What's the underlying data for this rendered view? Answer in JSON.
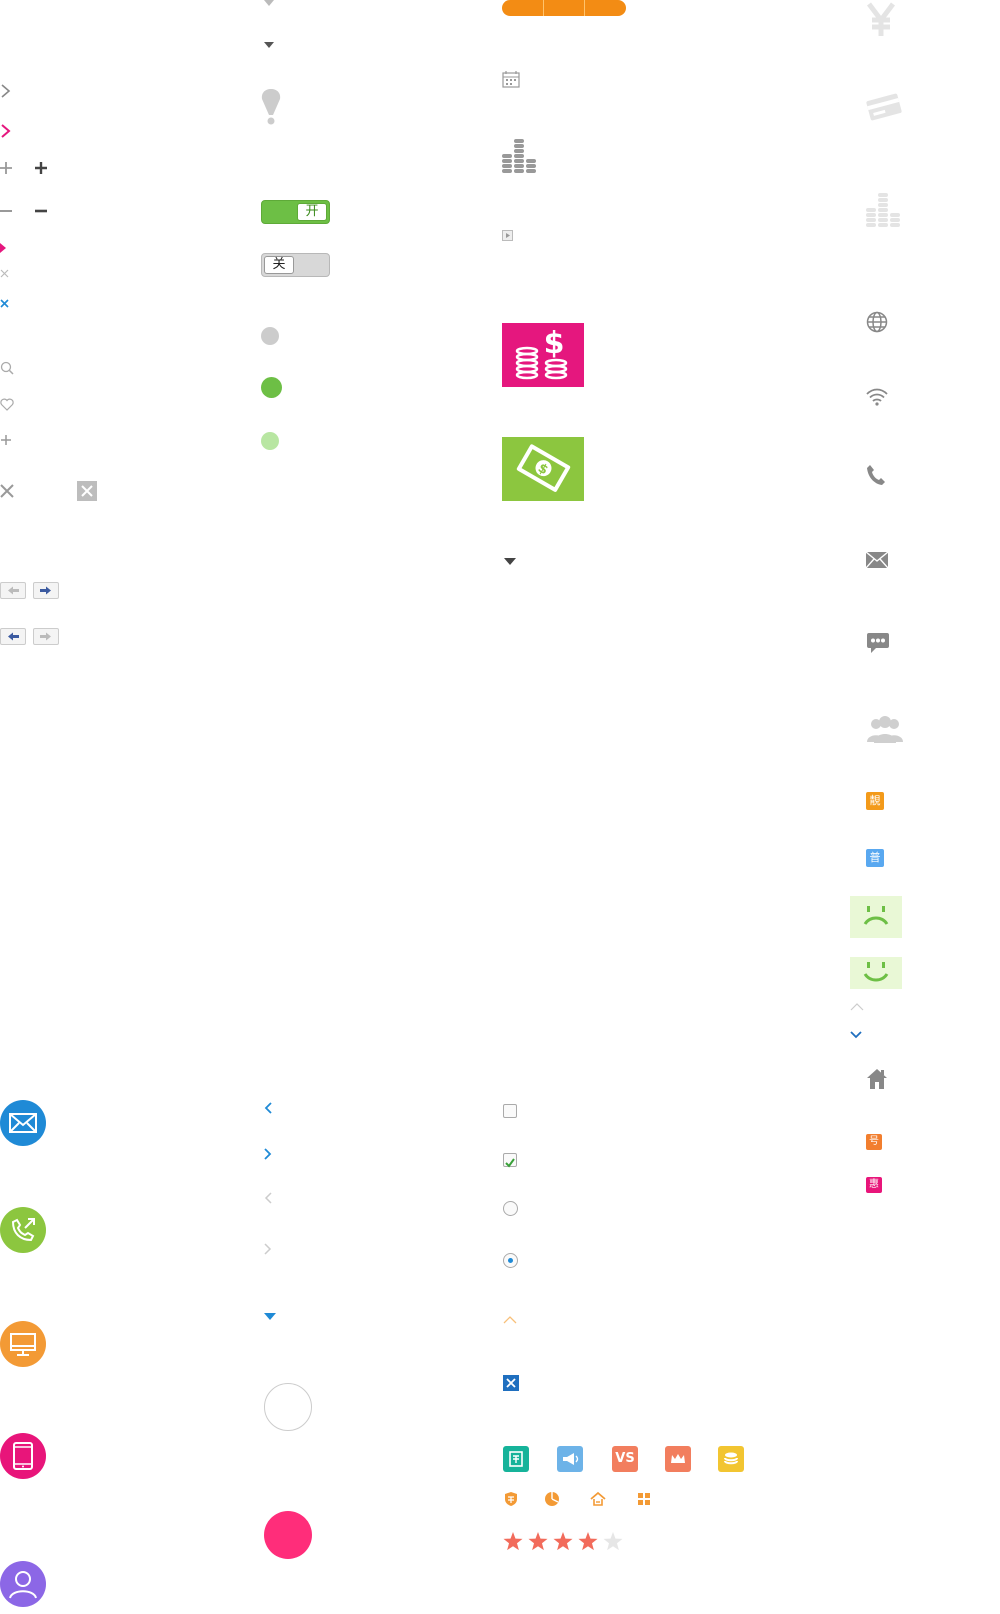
{
  "toggles": {
    "on_label": "开",
    "off_label": "关"
  },
  "tags": {
    "liang": "靚",
    "pu": "普",
    "hao": "号",
    "hui": "惠"
  },
  "vs_label": "VS",
  "rating": {
    "value": 4,
    "max": 5
  },
  "colors": {
    "magenta": "#e5177e",
    "green": "#8cc63f",
    "blue": "#1f8ad6",
    "orange": "#f39a35",
    "pink": "#e8157a",
    "purple": "#8c67e6",
    "star": "#f26b5b",
    "teal": "#16b39a",
    "sky": "#6db3e8",
    "coral": "#f27e5e",
    "yellow": "#f2c531"
  }
}
